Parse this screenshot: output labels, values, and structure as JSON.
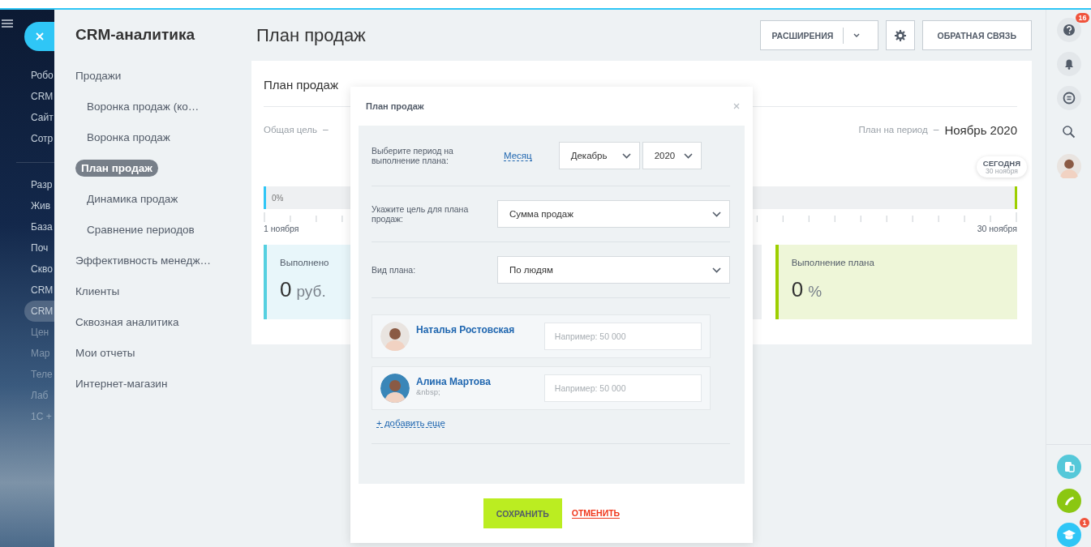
{
  "left_menu": {
    "items": [
      {
        "label": "Робо",
        "selected": false
      },
      {
        "label": "CRM",
        "selected": false
      },
      {
        "label": "Сайт",
        "selected": false
      },
      {
        "label": "Сотр",
        "selected": false
      },
      {
        "label": "Разр",
        "selected": false,
        "group_start": true
      },
      {
        "label": "Жив",
        "selected": false
      },
      {
        "label": "База",
        "selected": false
      },
      {
        "label": "Поч",
        "selected": false
      },
      {
        "label": "Скво",
        "selected": false
      },
      {
        "label": "CRM",
        "selected": false
      },
      {
        "label": "CRM",
        "selected": true
      },
      {
        "label": "Цен",
        "selected": false
      },
      {
        "label": "Мар",
        "selected": false
      },
      {
        "label": "Теле",
        "selected": false
      },
      {
        "label": "Лаб",
        "selected": false
      },
      {
        "label": "1С +",
        "selected": false
      }
    ]
  },
  "panel": {
    "title": "CRM-аналитика",
    "nav": [
      {
        "label": "Продажи",
        "selected": false,
        "children": [
          {
            "label": "Воронка продаж (ко…",
            "selected": false
          },
          {
            "label": "Воронка продаж",
            "selected": false
          },
          {
            "label": "План продаж",
            "selected": true
          },
          {
            "label": "Динамика продаж",
            "selected": false
          },
          {
            "label": "Сравнение периодов",
            "selected": false
          }
        ]
      },
      {
        "label": "Эффективность менедж…",
        "selected": false
      },
      {
        "label": "Клиенты",
        "selected": false
      },
      {
        "label": "Сквозная аналитика",
        "selected": false
      },
      {
        "label": "Мои отчеты",
        "selected": false
      },
      {
        "label": "Интернет-магазин",
        "selected": false
      }
    ]
  },
  "page": {
    "title": "План продаж",
    "toolbar": {
      "extensions": "РАСШИРЕНИЯ",
      "feedback": "ОБРАТНАЯ СВЯЗЬ"
    }
  },
  "card": {
    "title": "План продаж",
    "goal_label": "Общая цель",
    "goal_dash": "–",
    "period_label": "План на период",
    "period_dash": "–",
    "period_value": "Ноябрь 2020",
    "today": {
      "label": "СЕГОДНЯ",
      "date": "30 ноября"
    },
    "timeline": {
      "level": 0,
      "reading": "0%",
      "start": "1 ноября",
      "end": "30 ноября"
    },
    "stats": [
      {
        "label": "Выполнено",
        "value": "0",
        "unit": "руб.",
        "color": "#55d0e0"
      },
      {
        "color": "#dfe3e6"
      },
      {
        "label": "Выполнение плана",
        "value": "0",
        "unit": "%",
        "color": "#9dcf00"
      }
    ]
  },
  "dialog": {
    "title": "План продаж",
    "period": {
      "label": "Выберите период на выполнение плана:",
      "mode": "Месяц",
      "month": "Декабрь",
      "year": "2020"
    },
    "goal": {
      "label": "Укажите цель для плана продаж:",
      "value": "Сумма продаж"
    },
    "plan_type": {
      "label": "Вид плана:",
      "value": "По людям"
    },
    "people": [
      {
        "name": "Наталья Ростовская",
        "placeholder": "Например: 50 000"
      },
      {
        "name": "Алина Мартова",
        "subtitle": "&nbsp;",
        "placeholder": "Например: 50 000"
      }
    ],
    "add_link": "+ добавить еще",
    "buttons": {
      "save": "СОХРАНИТЬ",
      "cancel": "ОТМЕНИТЬ"
    }
  },
  "right_bar": {
    "help_badge": "16",
    "education_badge": "1"
  }
}
